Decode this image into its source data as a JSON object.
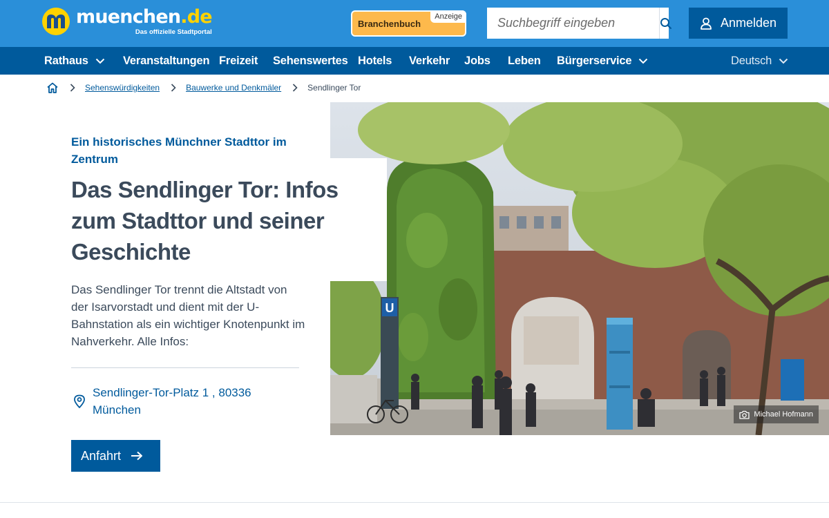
{
  "header": {
    "logo_main": "muenchen",
    "logo_tld": ".de",
    "logo_sub": "Das offizielle Stadtportal",
    "branchenbuch_label": "Branchenbuch",
    "anzeige_label": "Anzeige",
    "search_placeholder": "Suchbegriff eingeben",
    "login_label": "Anmelden"
  },
  "nav": {
    "items": [
      {
        "label": "Rathaus",
        "has_dropdown": true
      },
      {
        "label": "Veranstaltungen"
      },
      {
        "label": "Freizeit"
      },
      {
        "label": "Sehenswertes"
      },
      {
        "label": "Hotels"
      },
      {
        "label": "Verkehr"
      },
      {
        "label": "Jobs"
      },
      {
        "label": "Leben"
      },
      {
        "label": "Bürgerservice",
        "has_dropdown": true
      }
    ],
    "language": "Deutsch"
  },
  "breadcrumb": {
    "items": [
      "Sehenswürdigkeiten",
      "Bauwerke und Denkmäler"
    ],
    "current": "Sendlinger Tor"
  },
  "hero": {
    "kicker": "Ein historisches Münchner Stadttor im Zentrum",
    "title": "Das Sendlinger Tor: Infos zum Stadttor und seiner Geschichte",
    "intro": "Das Sendlinger Tor trennt die Altstadt von der Isarvorstadt und dient mit der U-Bahnstation als ein wichtiger Knotenpunkt im Nahverkehr. Alle Infos:",
    "address_line1": "Sendlinger-Tor-Platz 1 , 80336",
    "address_line2": "München",
    "anfahrt_label": "Anfahrt",
    "photo_credit": "Michael Hofmann",
    "u_sign": "U"
  },
  "colors": {
    "header_blue": "#2a8fd9",
    "nav_blue": "#005a9c",
    "accent_yellow": "#ffd200",
    "branchenbuch_orange": "#fdb94c"
  }
}
